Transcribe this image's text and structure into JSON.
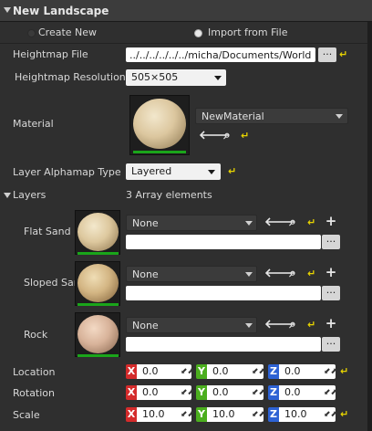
{
  "header": {
    "title": "New Landscape"
  },
  "mode": {
    "create_new_label": "Create New",
    "import_label": "Import from File",
    "selected": "import"
  },
  "heightmap_file": {
    "label": "Heightmap File",
    "value": "../../../../../../micha/Documents/World M",
    "browse_label": "..."
  },
  "heightmap_resolution": {
    "label": "Heightmap Resolution",
    "value": "505×505"
  },
  "material": {
    "label": "Material",
    "value": "NewMaterial"
  },
  "layer_alphamap": {
    "label": "Layer Alphamap Type",
    "value": "Layered"
  },
  "layers": {
    "label": "Layers",
    "count_text": "3 Array elements",
    "items": [
      {
        "name": "Flat Sand",
        "asset": "None",
        "browse_label": "..."
      },
      {
        "name": "Sloped Sar",
        "asset": "None",
        "browse_label": "..."
      },
      {
        "name": "Rock",
        "asset": "None",
        "browse_label": "..."
      }
    ]
  },
  "location": {
    "label": "Location",
    "x": "0.0",
    "y": "0.0",
    "z": "0.0"
  },
  "rotation": {
    "label": "Rotation",
    "x": "0.0",
    "y": "0.0",
    "z": "0.0"
  },
  "scale": {
    "label": "Scale",
    "x": "10.0",
    "y": "10.0",
    "z": "10.0"
  },
  "axis_labels": {
    "x": "X",
    "y": "Y",
    "z": "Z"
  },
  "icons": {
    "reset": "reset-arrow-icon",
    "use": "left-arrow-icon",
    "browse": "magnifier-icon",
    "add": "plus-icon"
  },
  "colors": {
    "x_axis": "#d42b2b",
    "y_axis": "#4bae1e",
    "z_axis": "#2d62d4",
    "reset": "#e8d400"
  }
}
